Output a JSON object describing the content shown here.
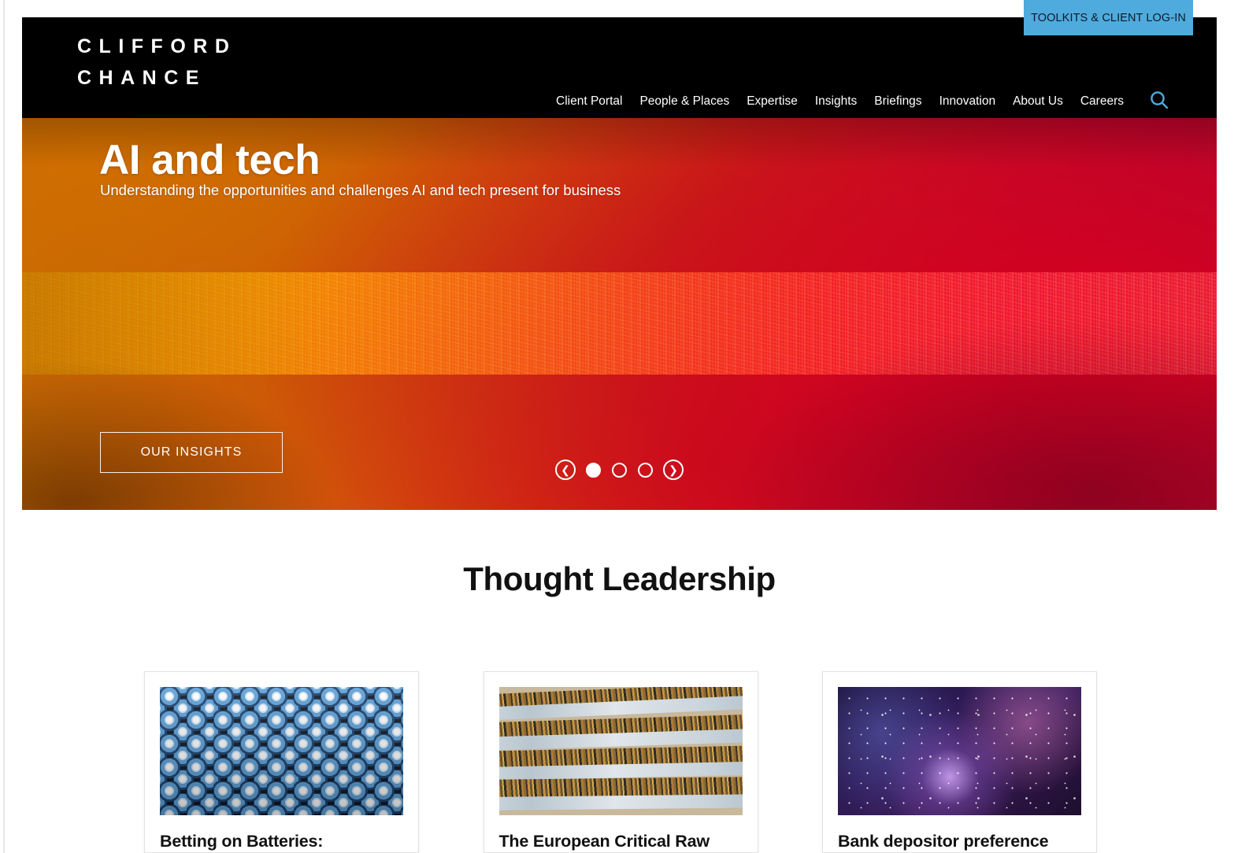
{
  "topbar": {
    "toolkits_label": "TOOLKITS & CLIENT LOG-IN"
  },
  "header": {
    "logo_line1": "CLIFFORD",
    "logo_line2": "CHANCE",
    "nav_items": [
      {
        "label": "Client Portal"
      },
      {
        "label": "People & Places"
      },
      {
        "label": "Expertise"
      },
      {
        "label": "Insights"
      },
      {
        "label": "Briefings"
      },
      {
        "label": "Innovation"
      },
      {
        "label": "About Us"
      },
      {
        "label": "Careers"
      }
    ],
    "search_icon": "search-icon",
    "search_icon_color": "#4fabdd",
    "background_color": "#000000"
  },
  "hero": {
    "title": "AI and tech",
    "subtitle": "Understanding the opportunities and challenges AI and tech present for business",
    "cta_label": "OUR INSIGHTS",
    "carousel": {
      "prev_icon": "chevron-left-icon",
      "next_icon": "chevron-right-icon",
      "slide_count": 3,
      "active_slide": 1
    },
    "accent_colors": {
      "orange": "#c97404",
      "red": "#d11415",
      "crimson": "#b00a33"
    }
  },
  "thought_leadership": {
    "heading": "Thought Leadership",
    "cards": [
      {
        "title": "Betting on Batteries:",
        "image_name": "batteries-image"
      },
      {
        "title": "The European Critical Raw",
        "image_name": "open-pit-mine-image"
      },
      {
        "title": "Bank depositor preference",
        "image_name": "galaxy-image"
      }
    ]
  }
}
